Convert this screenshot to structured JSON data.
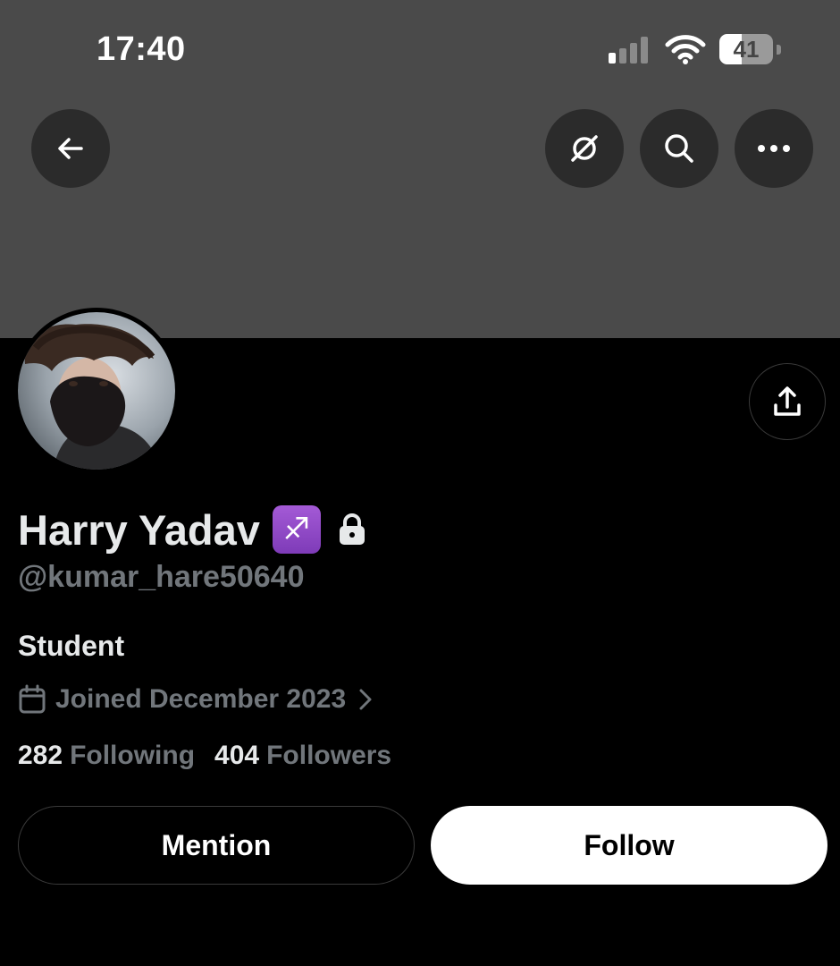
{
  "status_bar": {
    "time": "17:40",
    "battery_level": "41",
    "battery_fraction": 0.41,
    "signal_bars_active": 1,
    "signal_bars_total": 4
  },
  "top_bar": {
    "back_icon": "arrow-left-icon",
    "grok_icon": "grok-icon",
    "search_icon": "search-icon",
    "more_icon": "more-horizontal-icon"
  },
  "profile": {
    "display_name": "Harry Yadav",
    "zodiac_emoji": "♐",
    "handle": "@kumar_hare50640",
    "bio": "Student",
    "joined": "Joined December 2023",
    "following_count": "282",
    "following_label": "Following",
    "followers_count": "404",
    "followers_label": "Followers"
  },
  "actions": {
    "mention_label": "Mention",
    "follow_label": "Follow"
  },
  "colors": {
    "banner": "#4a4a4a",
    "background": "#000000",
    "secondary_text": "#71767b",
    "badge_purple": "#8e44c9"
  }
}
